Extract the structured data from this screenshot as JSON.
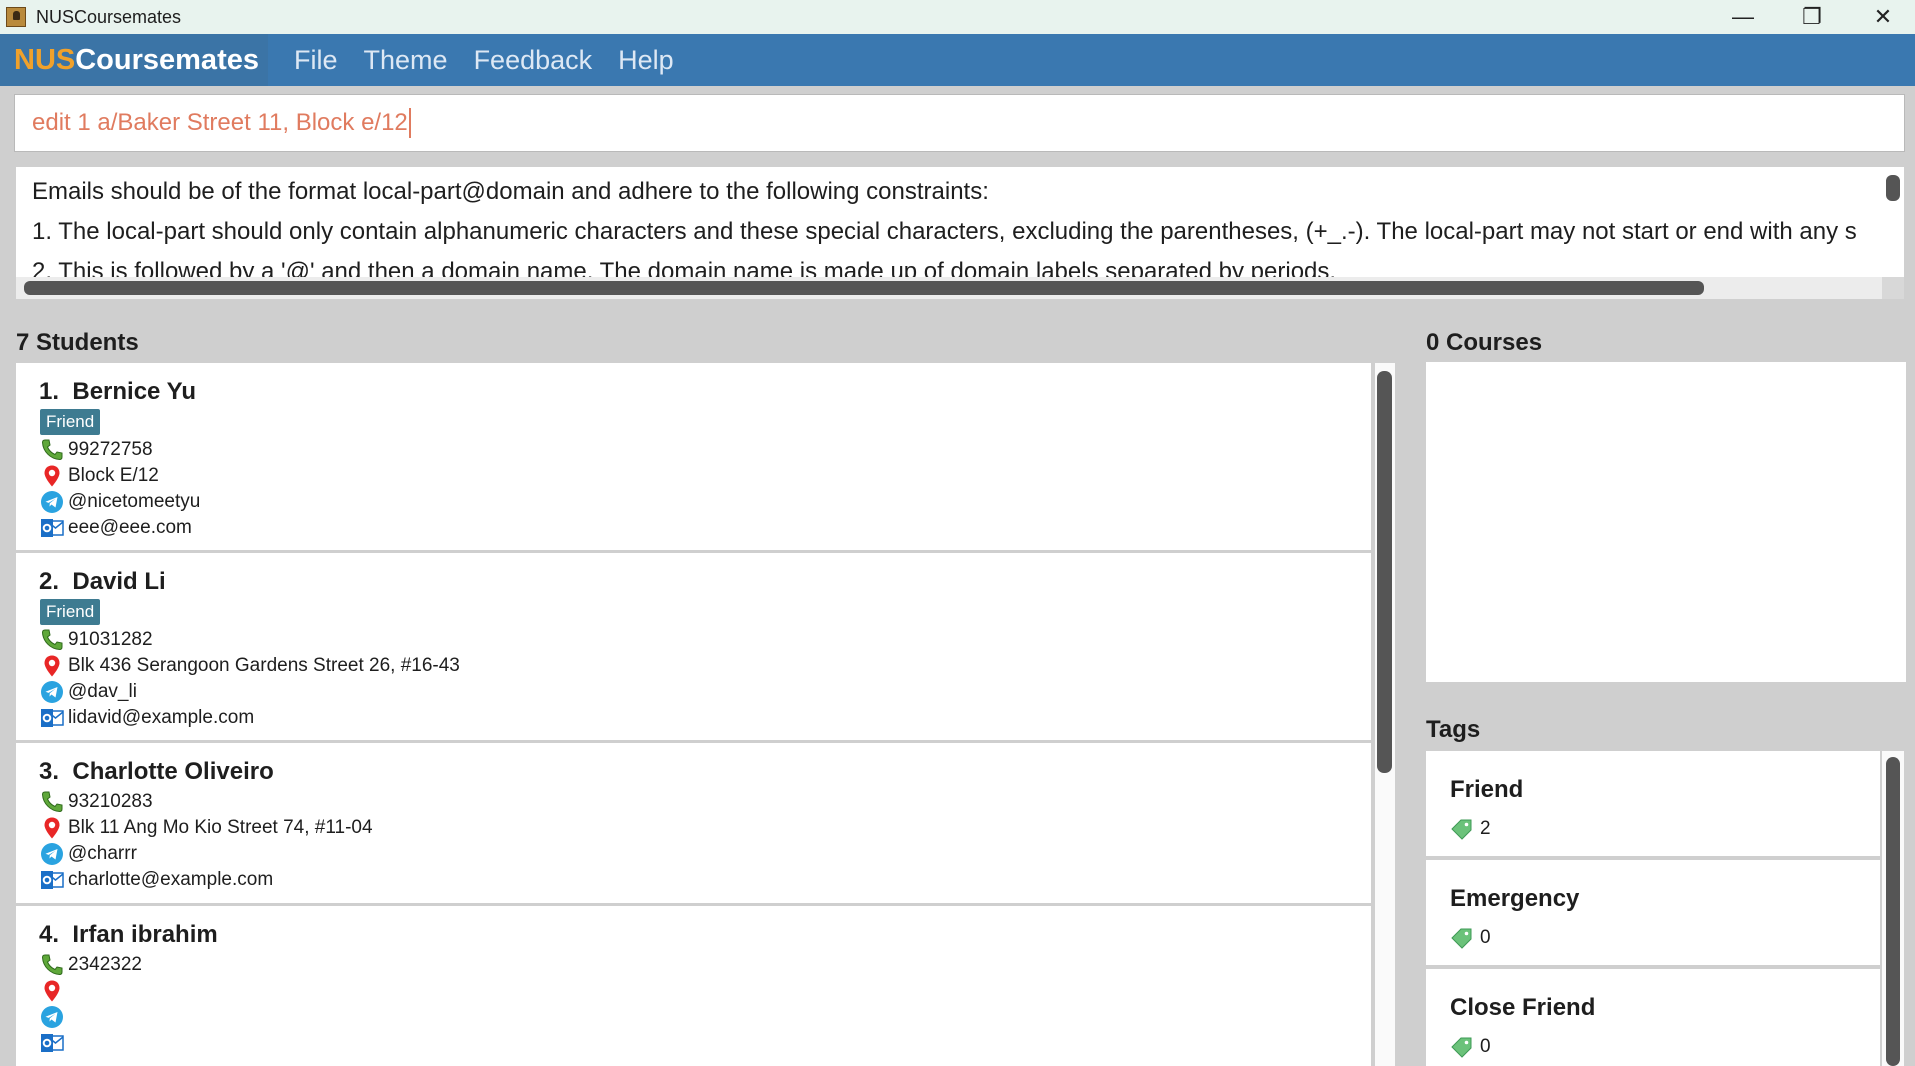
{
  "window": {
    "title": "NUSCoursemates",
    "controls": {
      "minimize": "—",
      "maximize": "❐",
      "close": "✕"
    }
  },
  "menubar": {
    "logo_part1": "NUS",
    "logo_part2": "Coursemates",
    "items": [
      "File",
      "Theme",
      "Feedback",
      "Help"
    ]
  },
  "command_box": {
    "value": "edit 1 a/Baker Street 11, Block e/12"
  },
  "result_display": {
    "lines": [
      "Emails should be of the format local-part@domain and adhere to the following constraints:",
      "1. The local-part should only contain alphanumeric characters and these special characters, excluding the parentheses, (+_.-). The local-part may not start or end with any s",
      "2. This is followed by a '@' and then a domain name. The domain name is made up of domain labels separated by periods."
    ]
  },
  "students": {
    "header": "7 Students",
    "items": [
      {
        "index": "1.",
        "name": "Bernice Yu",
        "tag": "Friend",
        "phone": "99272758",
        "address": "Block E/12",
        "telegram": "@nicetomeetyu",
        "email": "eee@eee.com"
      },
      {
        "index": "2.",
        "name": "David Li",
        "tag": "Friend",
        "phone": "91031282",
        "address": "Blk 436 Serangoon Gardens Street 26, #16-43",
        "telegram": "@dav_li",
        "email": "lidavid@example.com"
      },
      {
        "index": "3.",
        "name": "Charlotte Oliveiro",
        "tag": "",
        "phone": "93210283",
        "address": "Blk 11 Ang Mo Kio Street 74, #11-04",
        "telegram": "@charrr",
        "email": "charlotte@example.com"
      },
      {
        "index": "4.",
        "name": "Irfan ibrahim",
        "tag": "",
        "phone": "2342322",
        "address": "",
        "telegram": "",
        "email": ""
      }
    ]
  },
  "courses": {
    "header": "0 Courses"
  },
  "tags": {
    "header": "Tags",
    "items": [
      {
        "name": "Friend",
        "count": "2"
      },
      {
        "name": "Emergency",
        "count": "0"
      },
      {
        "name": "Close Friend",
        "count": "0"
      }
    ]
  },
  "colors": {
    "menubar": "#3a78b0",
    "logo_accent": "#f0a12b",
    "command_text": "#e07b5f",
    "tag_badge": "#3e7b91",
    "phone_icon": "#5fa83a",
    "address_icon": "#e82626",
    "telegram_icon": "#2aa3e0",
    "email_icon": "#1a6fc7",
    "tag_icon": "#6bc27a"
  },
  "icons": {
    "phone": "phone-icon",
    "address": "location-pin-icon",
    "telegram": "telegram-icon",
    "email": "outlook-mail-icon",
    "tag": "tag-icon"
  }
}
